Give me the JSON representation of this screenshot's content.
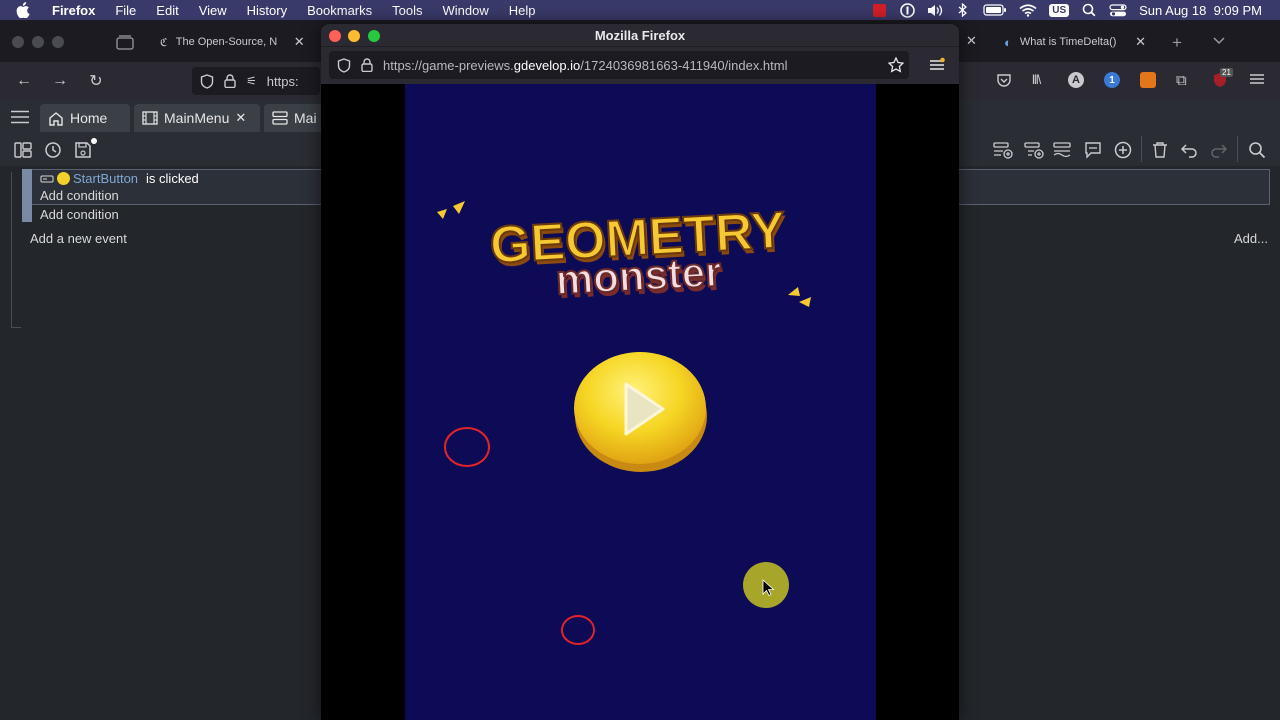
{
  "menubar": {
    "app": "Firefox",
    "items": [
      "File",
      "Edit",
      "View",
      "History",
      "Bookmarks",
      "Tools",
      "Window",
      "Help"
    ],
    "keyboard": "US",
    "datetime": "Sun Aug 18  9:09 PM"
  },
  "bg_browser": {
    "tabs": [
      "The Open-Source, N",
      "What is TimeDelta()"
    ],
    "url_partial": "https:",
    "badge_count": "21"
  },
  "editor": {
    "tabs": [
      "Home",
      "MainMenu",
      "Mai"
    ],
    "event": {
      "object": "StartButton",
      "condition_text": "is clicked",
      "add_condition_1": "Add condition",
      "add_condition_2": "Add condition"
    },
    "add_new_event": "Add a new event",
    "add_right": "Add..."
  },
  "popup": {
    "title": "Mozilla Firefox",
    "url_prefix": "https://game-previews.",
    "url_host": "gdevelop.io",
    "url_path": "/1724036981663-411940/index.html"
  },
  "game": {
    "title_line1": "GEOMETRY",
    "title_line2": "monster",
    "colors": {
      "background": "#0d0a56",
      "title": "#f6c933",
      "subtitle": "#f3dde0",
      "button": "#f7d92d",
      "ring": "#e0242a",
      "player": "#a7a52a"
    }
  }
}
